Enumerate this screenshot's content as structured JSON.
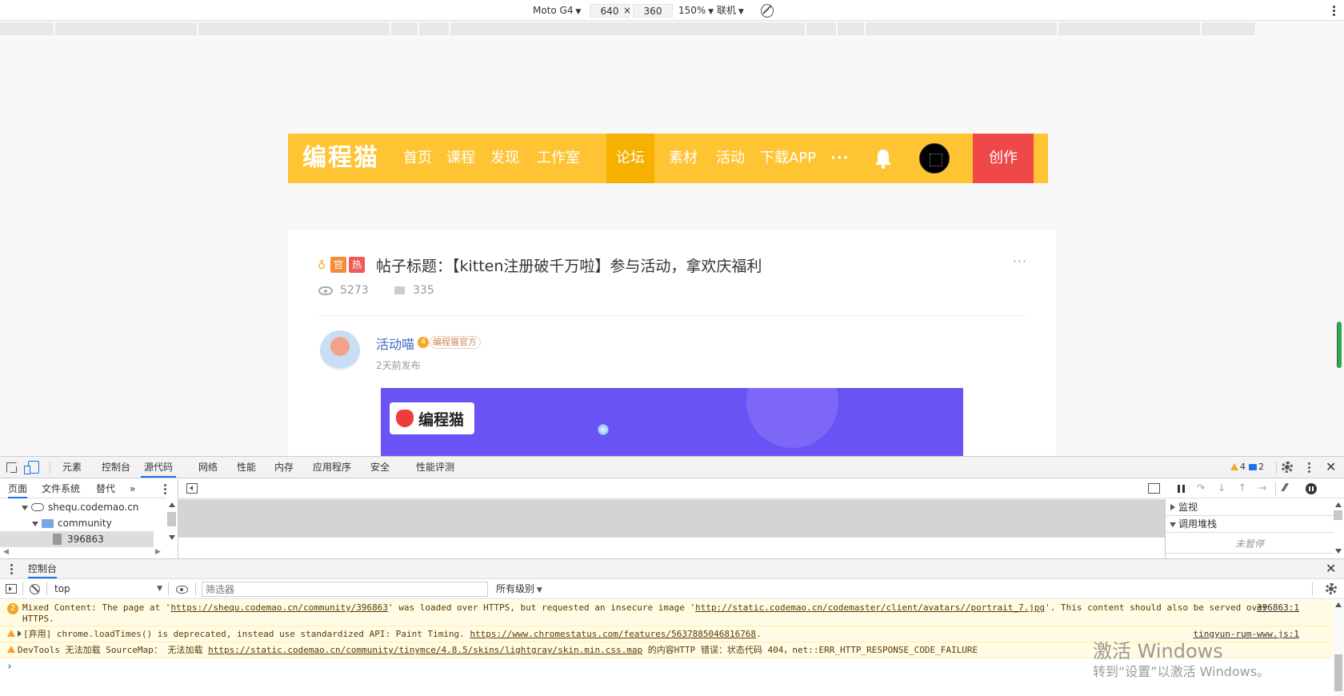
{
  "device_toolbar": {
    "device": "Moto G4",
    "width_value": "640",
    "height_value": "360",
    "times": "×",
    "zoom": "150%",
    "network": "联机"
  },
  "site": {
    "logo": "编程猫",
    "nav_items": [
      "首页",
      "课程",
      "发现",
      "工作室",
      "论坛",
      "素材",
      "活动",
      "下载APP"
    ],
    "active_nav": "论坛",
    "more": "···",
    "create_label": "创作",
    "colors": {
      "nav_bg": "#fec433",
      "nav_active": "#f5b000",
      "create_bg": "#ef4848",
      "banner_bg": "#6a53f5"
    }
  },
  "post": {
    "badge_ring": "♁",
    "badge_official": "官",
    "badge_hot": "热",
    "title": "帖子标题：【kitten注册破千万啦】参与活动，拿欢庆福利",
    "menu": "···",
    "views": "5273",
    "comments": "335",
    "author": {
      "name": "活动喵",
      "level": "4",
      "tag": "编程猫官方",
      "time": "2天前发布"
    },
    "banner": {
      "logo_text": "编程猫"
    }
  },
  "devtools": {
    "tabs": [
      "元素",
      "控制台",
      "源代码",
      "网络",
      "性能",
      "内存",
      "应用程序",
      "安全",
      "性能评测"
    ],
    "active_tab": "源代码",
    "warning_count": "4",
    "message_count": "2",
    "sources": {
      "nav_tabs": [
        "页面",
        "文件系统",
        "替代",
        "»"
      ],
      "tree": [
        {
          "label": "shequ.codemao.cn",
          "icon": "cloud-icon"
        },
        {
          "label": "community",
          "icon": "folder-icon"
        },
        {
          "label": "396863",
          "icon": "file-icon"
        }
      ],
      "debugger": {
        "watch": "监视",
        "call_stack": "调用堆栈",
        "not_paused": "未暂停"
      }
    },
    "drawer": {
      "title": "控制台",
      "context": "top",
      "filter_placeholder": "筛选器",
      "levels": "所有级别",
      "messages": [
        {
          "count": "2",
          "p1": "Mixed Content: The page at '",
          "link1": "https://shequ.codemao.cn/community/396863",
          "p2": "' was loaded over HTTPS, but requested an insecure image '",
          "link2": "http://static.codemao.cn/codemaster/client/avatars//portrait_7.jpg",
          "p3": "'. This content should also be served over",
          "line2": "HTTPS.",
          "source": "396863:1"
        },
        {
          "p1": "[弃用] chrome.loadTimes() is deprecated, instead use standardized API: Paint Timing. ",
          "link1": "https://www.chromestatus.com/features/5637885046816768",
          "p2": ".",
          "source": "tingyun-rum-www.js:1"
        },
        {
          "p1": "DevTools 无法加载 SourceMap： 无法加载 ",
          "link1": "https://static.codemao.cn/community/tinymce/4.8.5/skins/lightgray/skin.min.css.map",
          "p2": " 的内容HTTP 错误：状态代码 404，net::ERR_HTTP_RESPONSE_CODE_FAILURE"
        }
      ],
      "prompt": "›"
    }
  },
  "watermark": {
    "line1": "激活 Windows",
    "line2": "转到“设置”以激活 Windows。"
  }
}
